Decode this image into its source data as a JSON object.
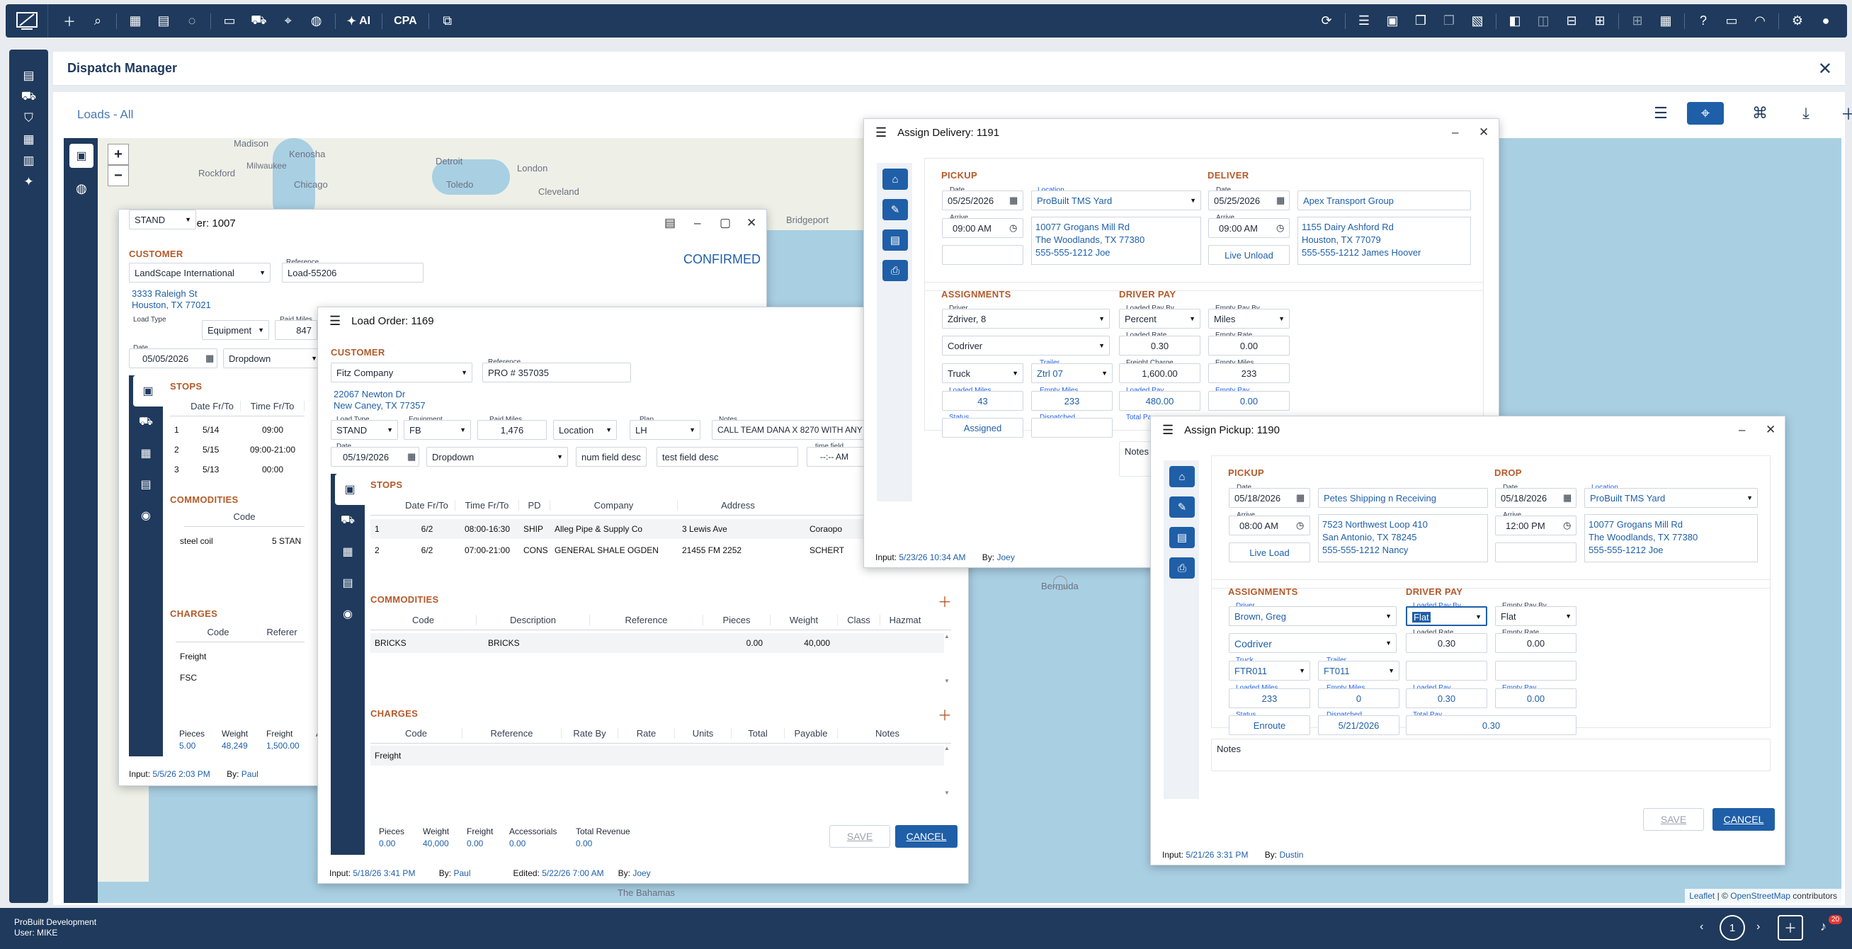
{
  "topbar": {
    "ai_label": "AI",
    "cpa_label": "CPA"
  },
  "header": {
    "title": "Dispatch Manager"
  },
  "panel": {
    "loads_title": "Loads - All"
  },
  "map": {
    "labels": [
      "Madison",
      "Kenosha",
      "Milwaukee",
      "Detroit",
      "Rockford",
      "Chicago",
      "London",
      "Toledo",
      "Cleveland",
      "Bridgeport",
      "Bermuda",
      "The Bahamas"
    ],
    "attribution_leaflet": "Leaflet",
    "attribution_sep": "|",
    "attribution_copy": "©",
    "attribution_osm": "OpenStreetMap",
    "attribution_tail": "contributors"
  },
  "lo1007": {
    "title": "Load Order: 1007",
    "status": "CONFIRMED",
    "customer_label": "CUSTOMER",
    "customer": "LandScape International",
    "ref_label": "Reference",
    "ref": "Load-55206",
    "addr1": "3333 Raleigh St",
    "addr2": "Houston, TX 77021",
    "lt_label": "Load Type",
    "load_type": "STAND",
    "equipment": "Equipment",
    "paid_label": "Paid Miles",
    "paid_miles": "847",
    "date_label": "Date",
    "date": "05/05/2026",
    "dropdown": "Dropdown",
    "stops_label": "STOPS",
    "stop_cols": [
      "Date Fr/To",
      "Time Fr/To"
    ],
    "stops": [
      {
        "n": "1",
        "date": "5/14",
        "time": "09:00"
      },
      {
        "n": "2",
        "date": "5/15",
        "time": "09:00-21:00"
      },
      {
        "n": "3",
        "date": "5/13",
        "time": "00:00"
      }
    ],
    "comm_label": "COMMODITIES",
    "comm_col": "Code",
    "comm_row": "steel coil",
    "comm_row2": "5 STAN",
    "charges_label": "CHARGES",
    "charges_cols": [
      "Code",
      "Referer"
    ],
    "charges": [
      "Freight",
      "FSC"
    ],
    "sum": [
      {
        "k": "Pieces",
        "v": "5.00"
      },
      {
        "k": "Weight",
        "v": "48,249"
      },
      {
        "k": "Freight",
        "v": "1,500.00"
      },
      {
        "k": "A",
        "v": ""
      }
    ],
    "input_label": "Input:",
    "input": "5/5/26 2:03 PM",
    "by_label": "By:",
    "by": "Paul"
  },
  "lo1169": {
    "title": "Load Order: 1169",
    "customer_label": "CUSTOMER",
    "customer": "Fitz Company",
    "ref_label": "Reference",
    "ref": "PRO # 357035",
    "addr1": "22067 Newton Dr",
    "addr2": "New Caney, TX 77357",
    "lt_label": "Load Type",
    "load_type": "STAND",
    "eq_label": "Equipment",
    "equipment": "FB",
    "paid_label": "Paid Miles",
    "paid_miles": "1,476",
    "location": "Location",
    "plan_label": "Plan",
    "plan": "LH",
    "notes_label": "Notes",
    "notes": "CALL TEAM DANA X 8270 WITH ANY",
    "date_label": "Date",
    "date": "05/19/2026",
    "dropdown": "Dropdown",
    "num_field": "num field desc",
    "test_field": "test field desc",
    "time_label": "time field",
    "time": "--:-- AM",
    "stops_label": "STOPS",
    "stop_cols": [
      "Date Fr/To",
      "Time Fr/To",
      "PD",
      "Company",
      "Address"
    ],
    "stops": [
      {
        "n": "1",
        "date": "6/2",
        "time": "08:00-16:30",
        "pd": "SHIP",
        "company": "Alleg Pipe & Supply Co",
        "address": "3 Lewis Ave",
        "city": "Coraopo"
      },
      {
        "n": "2",
        "date": "6/2",
        "time": "07:00-21:00",
        "pd": "CONS",
        "company": "GENERAL SHALE OGDEN",
        "address": "21455 FM 2252",
        "city": "SCHERT"
      }
    ],
    "comm_label": "COMMODITIES",
    "comm_cols": [
      "Code",
      "Description",
      "Reference",
      "Pieces",
      "Weight",
      "Class",
      "Hazmat"
    ],
    "comm_row": {
      "code": "BRICKS",
      "desc": "BRICKS",
      "pieces": "0.00",
      "weight": "40,000"
    },
    "charges_label": "CHARGES",
    "charges_cols": [
      "Code",
      "Reference",
      "Rate By",
      "Rate",
      "Units",
      "Total",
      "Payable",
      "Notes"
    ],
    "charge_row": "Freight",
    "sum": [
      {
        "k": "Pieces",
        "v": "0.00"
      },
      {
        "k": "Weight",
        "v": "40,000"
      },
      {
        "k": "Freight",
        "v": "0.00"
      },
      {
        "k": "Accessorials",
        "v": "0.00"
      },
      {
        "k": "Total Revenue",
        "v": "0.00"
      }
    ],
    "save": "SAVE",
    "cancel": "CANCEL",
    "input_label": "Input:",
    "input": "5/18/26 3:41 PM",
    "by_label": "By:",
    "by": "Paul",
    "edited_label": "Edited:",
    "edited": "5/22/26 7:00 AM",
    "by2": "Joey"
  },
  "ad1191": {
    "title": "Assign Delivery: 1191",
    "pickup_label": "PICKUP",
    "deliver_label": "DELIVER",
    "date_label": "Date",
    "arrive_label": "Arrive",
    "loc_label": "Location",
    "p_date": "05/25/2026",
    "p_loc": "ProBuilt TMS Yard",
    "p_arrive": "09:00 AM",
    "p_addr1": "10077 Grogans Mill Rd",
    "p_addr2": "The Woodlands, TX 77380",
    "p_addr3": "555-555-1212   Joe",
    "d_date": "05/25/2026",
    "d_name": "Apex Transport Group",
    "d_arrive": "09:00 AM",
    "d_addr1": "1155 Dairy Ashford Rd",
    "d_addr2": "Houston, TX 77079",
    "d_addr3": "555-555-1212   James Hoover",
    "live_unload": "Live Unload",
    "assign_label": "ASSIGNMENTS",
    "driverpay_label": "DRIVER PAY",
    "driver_label": "Driver",
    "driver": "Zdriver, 8",
    "codriver": "Codriver",
    "truck": "Truck",
    "trailer_label": "Trailer",
    "trailer": "Ztrl 07",
    "lm_label": "Loaded Miles",
    "loaded_miles": "43",
    "em_label": "Empty Miles",
    "empty_miles": "233",
    "status_label": "Status",
    "status": "Assigned",
    "disp_label": "Dispatched",
    "lpb_label": "Loaded Pay By",
    "lpb": "Percent",
    "epb_label": "Empty Pay By",
    "epb": "Miles",
    "lr_label": "Loaded Rate",
    "lr": "0.30",
    "er_label": "Empty Rate",
    "er": "0.00",
    "fc_label": "Freight Charge",
    "fc": "1,600.00",
    "em2_label": "Empty Miles",
    "em2": "233",
    "lp_label": "Loaded Pay",
    "lp": "480.00",
    "ep_label": "Empty Pay",
    "ep": "0.00",
    "tp_label": "Total Pa",
    "notes": "Notes",
    "input_label": "Input:",
    "input": "5/23/26 10:34 AM",
    "by_label": "By:",
    "by": "Joey"
  },
  "ap1190": {
    "title": "Assign Pickup: 1190",
    "pickup_label": "PICKUP",
    "drop_label": "DROP",
    "date_label": "Date",
    "arrive_label": "Arrive",
    "loc_label": "Location",
    "p_date": "05/18/2026",
    "p_name": "Petes Shipping n Receiving",
    "p_arrive": "08:00 AM",
    "p_addr1": "7523 Northwest Loop 410",
    "p_addr2": "San Antonio, TX 78245",
    "p_addr3": "555-555-1212   Nancy",
    "live_load": "Live Load",
    "d_date": "05/18/2026",
    "d_loc": "ProBuilt TMS Yard",
    "d_arrive": "12:00 PM",
    "d_addr1": "10077 Grogans Mill Rd",
    "d_addr2": "The Woodlands, TX 77380",
    "d_addr3": "555-555-1212   Joe",
    "assign_label": "ASSIGNMENTS",
    "driverpay_label": "DRIVER PAY",
    "driver_label": "Driver",
    "driver": "Brown, Greg",
    "codriver": "Codriver",
    "truck_label": "Truck",
    "truck": "FTR011",
    "trailer_label": "Trailer",
    "trailer": "FT011",
    "lm_label": "Loaded Miles",
    "loaded_miles": "233",
    "em_label": "Empty Miles",
    "empty_miles": "0",
    "status_label": "Status",
    "status": "Enroute",
    "disp_label": "Dispatched",
    "dispatched": "5/21/2026",
    "lpb_label": "Loaded Pay By",
    "lpb": "Flat",
    "epb_label": "Empty Pay By",
    "epb": "Flat",
    "lr_label": "Loaded Rate",
    "lr": "0.30",
    "er_label": "Empty Rate",
    "er": "0.00",
    "lp_label": "Loaded Pay",
    "lp": "0.30",
    "ep_label": "Empty Pay",
    "ep": "0.00",
    "tp_label": "Total Pay",
    "tp": "0.30",
    "notes": "Notes",
    "save": "SAVE",
    "cancel": "CANCEL",
    "input_label": "Input:",
    "input": "5/21/26 3:31 PM",
    "by_label": "By:",
    "by": "Dustin"
  },
  "bottom": {
    "company": "ProBuilt Development",
    "user": "User: MIKE",
    "page": "1",
    "badge": "20"
  }
}
